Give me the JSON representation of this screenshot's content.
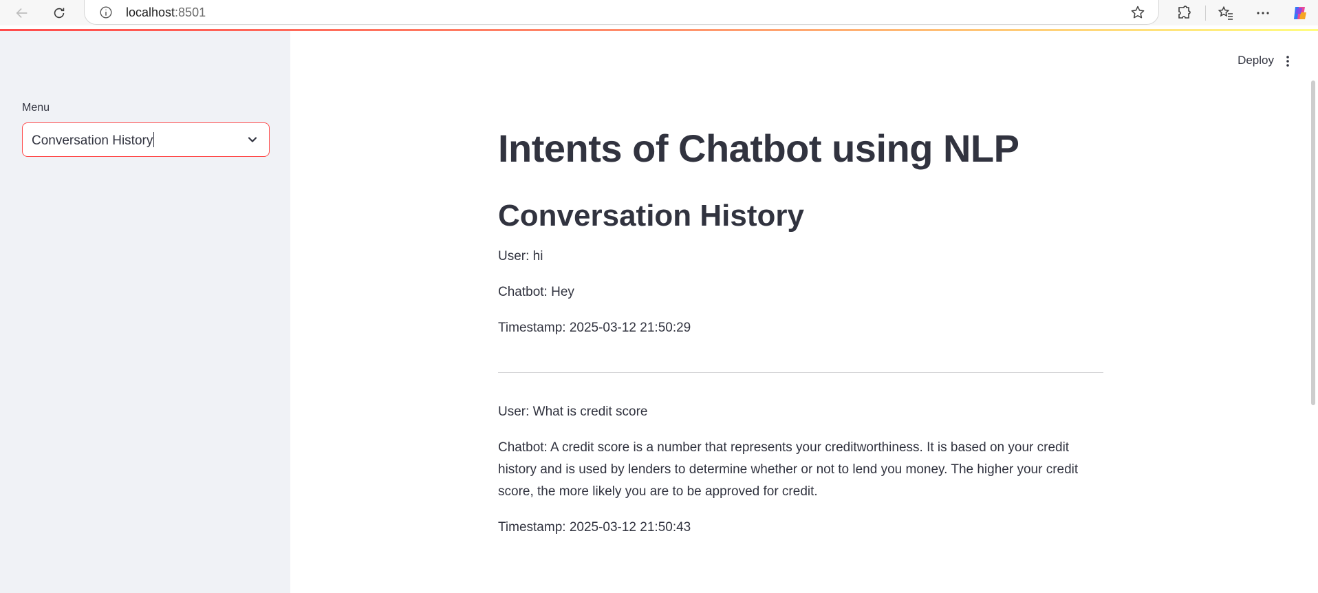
{
  "browser": {
    "address_host": "localhost",
    "address_port": ":8501"
  },
  "sidebar": {
    "menu_label": "Menu",
    "select_value": "Conversation History"
  },
  "header": {
    "deploy_label": "Deploy"
  },
  "main": {
    "title": "Intents of Chatbot using NLP",
    "section_title": "Conversation History",
    "conversations": [
      {
        "user": "User: hi",
        "chatbot": "Chatbot: Hey",
        "timestamp": "Timestamp: 2025-03-12 21:50:29"
      },
      {
        "user": "User: What is credit score",
        "chatbot": "Chatbot: A credit score is a number that represents your creditworthiness. It is based on your credit history and is used by lenders to determine whether or not to lend you money. The higher your credit score, the more likely you are to be approved for credit.",
        "timestamp": "Timestamp: 2025-03-12 21:50:43"
      }
    ]
  },
  "colors": {
    "accent": "#ff4b4b",
    "sidebar_bg": "#f0f2f6",
    "text": "#31333f"
  }
}
